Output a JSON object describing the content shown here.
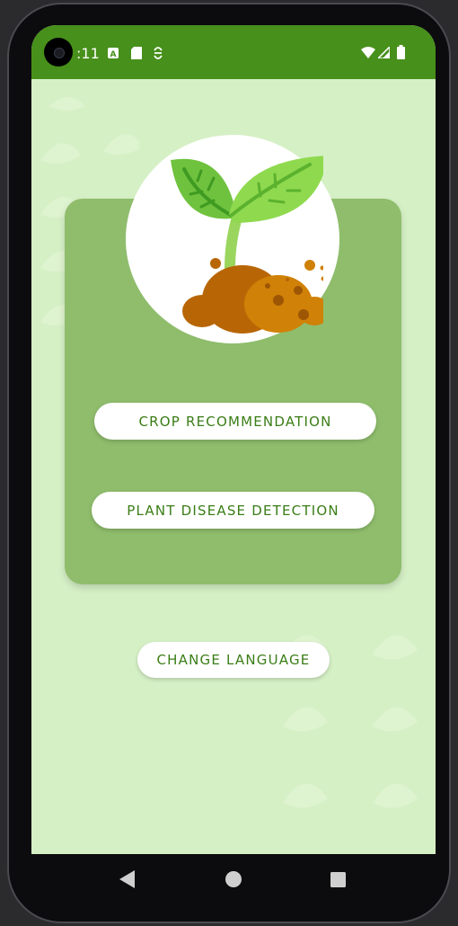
{
  "status_bar": {
    "time": ":11",
    "icons": [
      "a-icon",
      "sd-card-icon",
      "sync-icon",
      "wifi-icon",
      "cellular-icon",
      "battery-icon"
    ]
  },
  "main": {
    "crop_button_label": "CROP RECOMMENDATION",
    "disease_button_label": "PLANT DISEASE DETECTION",
    "language_button_label": "CHANGE LANGUAGE"
  },
  "navigation": {
    "back": "back-icon",
    "home": "home-icon",
    "recents": "recents-icon"
  },
  "colors": {
    "status_bar": "#47901b",
    "background": "#d6f0c6",
    "card": "#8fbd6c",
    "button_text": "#3a7d16"
  }
}
